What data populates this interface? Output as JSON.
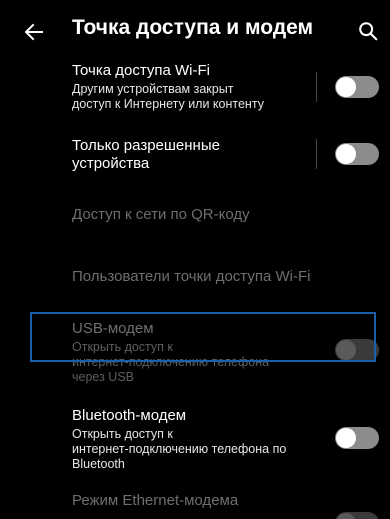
{
  "header": {
    "title": "Точка доступа и модем",
    "back_icon": "arrow-left-icon",
    "search_icon": "search-icon"
  },
  "items": [
    {
      "title": "Точка доступа Wi-Fi",
      "subtitle_lines": [
        "Другим устройствам закрыт",
        "доступ к Интернету или контенту"
      ],
      "toggle": "off",
      "enabled": true
    },
    {
      "title_lines": [
        "Только разрешенные",
        "устройства"
      ],
      "toggle": "off",
      "enabled": true
    },
    {
      "title": "Доступ к сети по QR-коду",
      "enabled": false
    },
    {
      "title": "Пользователи точки доступа Wi-Fi",
      "enabled": false
    },
    {
      "title": "USB-модем",
      "subtitle_lines": [
        "Открыть доступ к",
        "интернет-подключению телефона",
        "через USB"
      ],
      "toggle": "off",
      "enabled": false
    },
    {
      "title": "Bluetooth-модем",
      "subtitle_lines": [
        "Открыть доступ к",
        "интернет-подключению телефона по",
        "Bluetooth"
      ],
      "toggle": "off",
      "enabled": true
    },
    {
      "title": "Режим Ethernet-модема",
      "toggle": "off",
      "enabled": false
    }
  ],
  "colors": {
    "background": "#000000",
    "focus_outline": "#1a5fa8",
    "toggle_off": "#8c8c8c",
    "disabled_text": "#6e6e6e"
  }
}
